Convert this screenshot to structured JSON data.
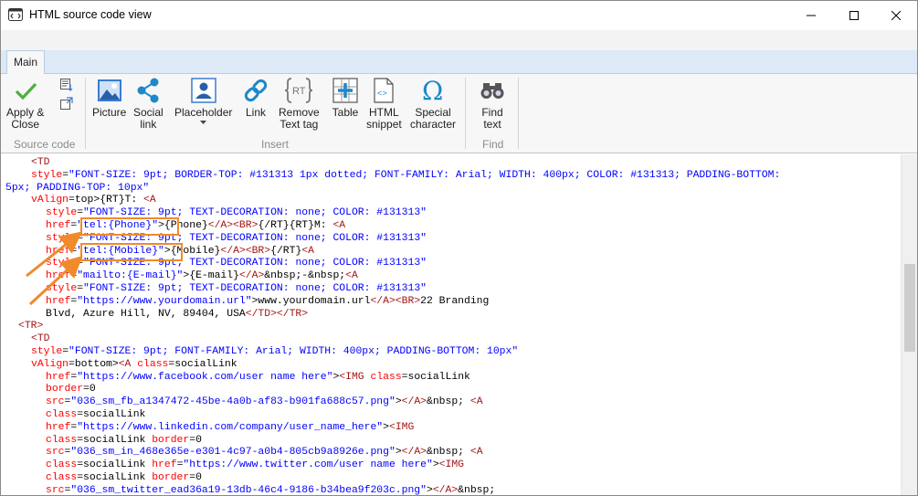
{
  "window": {
    "title": "HTML source code view",
    "icon": "app-code-icon"
  },
  "ribbon": {
    "tab_label": "Main",
    "buttons": {
      "apply": "Apply &\nClose",
      "picture": "Picture",
      "social": "Social\nlink",
      "placeholder": "Placeholder",
      "link": "Link",
      "remove_text": "Remove\nText tag",
      "table": "Table",
      "html_snippet": "HTML\nsnippet",
      "special": "Special\ncharacter",
      "find": "Find\ntext"
    },
    "groups": {
      "source_code": "Source code",
      "insert": "Insert",
      "find": "Find"
    }
  },
  "colors": {
    "tag": "#a31515",
    "attribute": "#ff0000",
    "value": "#0000ff",
    "highlight": "#f08a2a"
  },
  "code_lines": [
    [
      [
        "tg",
        "<TD"
      ]
    ],
    [
      [
        "at",
        "style"
      ],
      [
        "tx",
        "="
      ],
      [
        "vl",
        "\"FONT-SIZE: 9pt; BORDER-TOP: #131313 1px dotted; FONT-FAMILY: Arial; WIDTH: 400px; COLOR: #131313; PADDING-BOTTOM:"
      ]
    ],
    [
      [
        "vl",
        "5px; PADDING-TOP: 10px\""
      ]
    ],
    [
      [
        "at",
        "vAlign"
      ],
      [
        "tx",
        "=top>{RT}T: "
      ],
      [
        "tg",
        "<A"
      ]
    ],
    [
      [
        "at",
        "style"
      ],
      [
        "tx",
        "="
      ],
      [
        "vl",
        "\"FONT-SIZE: 9pt; TEXT-DECORATION: none; COLOR: #131313\""
      ]
    ],
    [
      [
        "at",
        "href"
      ],
      [
        "tx",
        "="
      ],
      [
        "vl",
        "\"tel:{Phone}\""
      ],
      [
        "tx",
        ">{Phone}"
      ],
      [
        "tg",
        "</A><BR>"
      ],
      [
        "tx",
        "{/RT}{RT}M: "
      ],
      [
        "tg",
        "<A"
      ]
    ],
    [
      [
        "at",
        "style"
      ],
      [
        "tx",
        "="
      ],
      [
        "vl",
        "\"FONT-SIZE: 9pt; TEXT-DECORATION: none; COLOR: #131313\""
      ]
    ],
    [
      [
        "at",
        "href"
      ],
      [
        "tx",
        "="
      ],
      [
        "vl",
        "\"tel:{Mobile}\""
      ],
      [
        "tx",
        ">{Mobile}"
      ],
      [
        "tg",
        "</A><BR>"
      ],
      [
        "tx",
        "{/RT}"
      ],
      [
        "tg",
        "<A"
      ]
    ],
    [
      [
        "at",
        "style"
      ],
      [
        "tx",
        "="
      ],
      [
        "vl",
        "\"FONT-SIZE: 9pt; TEXT-DECORATION: none; COLOR: #131313\""
      ]
    ],
    [
      [
        "at",
        "href"
      ],
      [
        "tx",
        "="
      ],
      [
        "vl",
        "\"mailto:{E-mail}\""
      ],
      [
        "tx",
        ">{E-mail}"
      ],
      [
        "tg",
        "</A>"
      ],
      [
        "tx",
        "&nbsp;-&nbsp;"
      ],
      [
        "tg",
        "<A"
      ]
    ],
    [
      [
        "at",
        "style"
      ],
      [
        "tx",
        "="
      ],
      [
        "vl",
        "\"FONT-SIZE: 9pt; TEXT-DECORATION: none; COLOR: #131313\""
      ]
    ],
    [
      [
        "at",
        "href"
      ],
      [
        "tx",
        "="
      ],
      [
        "vl",
        "\"https://www.yourdomain.url\""
      ],
      [
        "tx",
        ">www.yourdomain.url"
      ],
      [
        "tg",
        "</A><BR>"
      ],
      [
        "tx",
        "22 Branding"
      ]
    ],
    [
      [
        "tx",
        "Blvd, Azure Hill, NV, 89404, USA"
      ],
      [
        "tg",
        "</TD></TR>"
      ]
    ],
    [
      [
        "tg",
        "<TR>"
      ]
    ],
    [
      [
        "tg",
        "<TD"
      ]
    ],
    [
      [
        "at",
        "style"
      ],
      [
        "tx",
        "="
      ],
      [
        "vl",
        "\"FONT-SIZE: 9pt; FONT-FAMILY: Arial; WIDTH: 400px; PADDING-BOTTOM: 10px\""
      ]
    ],
    [
      [
        "at",
        "vAlign"
      ],
      [
        "tx",
        "=bottom>"
      ],
      [
        "tg",
        "<A "
      ],
      [
        "at",
        "class"
      ],
      [
        "tx",
        "=socialLink"
      ]
    ],
    [
      [
        "at",
        "href"
      ],
      [
        "tx",
        "="
      ],
      [
        "vl",
        "\"https://www.facebook.com/user name here\""
      ],
      [
        "tx",
        ">"
      ],
      [
        "tg",
        "<IMG "
      ],
      [
        "at",
        "class"
      ],
      [
        "tx",
        "=socialLink"
      ]
    ],
    [
      [
        "at",
        "border"
      ],
      [
        "tx",
        "=0"
      ]
    ],
    [
      [
        "at",
        "src"
      ],
      [
        "tx",
        "="
      ],
      [
        "vl",
        "\"036_sm_fb_a1347472-45be-4a0b-af83-b901fa688c57.png\""
      ],
      [
        "tx",
        ">"
      ],
      [
        "tg",
        "</A>"
      ],
      [
        "tx",
        "&nbsp; "
      ],
      [
        "tg",
        "<A"
      ]
    ],
    [
      [
        "at",
        "class"
      ],
      [
        "tx",
        "=socialLink"
      ]
    ],
    [
      [
        "at",
        "href"
      ],
      [
        "tx",
        "="
      ],
      [
        "vl",
        "\"https://www.linkedin.com/company/user_name_here\""
      ],
      [
        "tx",
        ">"
      ],
      [
        "tg",
        "<IMG"
      ]
    ],
    [
      [
        "at",
        "class"
      ],
      [
        "tx",
        "=socialLink "
      ],
      [
        "at",
        "border"
      ],
      [
        "tx",
        "=0"
      ]
    ],
    [
      [
        "at",
        "src"
      ],
      [
        "tx",
        "="
      ],
      [
        "vl",
        "\"036_sm_in_468e365e-e301-4c97-a0b4-805cb9a8926e.png\""
      ],
      [
        "tx",
        ">"
      ],
      [
        "tg",
        "</A>"
      ],
      [
        "tx",
        "&nbsp; "
      ],
      [
        "tg",
        "<A"
      ]
    ],
    [
      [
        "at",
        "class"
      ],
      [
        "tx",
        "=socialLink "
      ],
      [
        "at",
        "href"
      ],
      [
        "tx",
        "="
      ],
      [
        "vl",
        "\"https://www.twitter.com/user name here\""
      ],
      [
        "tx",
        ">"
      ],
      [
        "tg",
        "<IMG"
      ]
    ],
    [
      [
        "at",
        "class"
      ],
      [
        "tx",
        "=socialLink "
      ],
      [
        "at",
        "border"
      ],
      [
        "tx",
        "=0"
      ]
    ],
    [
      [
        "at",
        "src"
      ],
      [
        "tx",
        "="
      ],
      [
        "vl",
        "\"036_sm_twitter_ead36a19-13db-46c4-9186-b34bea9f203c.png\""
      ],
      [
        "tx",
        ">"
      ],
      [
        "tg",
        "</A>"
      ],
      [
        "tx",
        "&nbsp;"
      ]
    ]
  ]
}
